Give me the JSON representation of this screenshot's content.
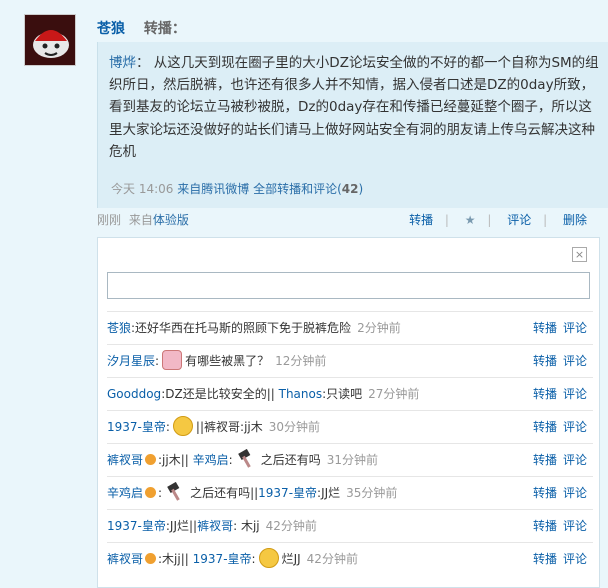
{
  "post": {
    "author": "苍狼",
    "action": "转播："
  },
  "quote": {
    "author": "博烨",
    "colon": "：",
    "text": "从这几天到现在圈子里的大小DZ论坛安全做的不好的都一个自称为SM的组织所日，然后脱裤，也许还有很多人并不知情，据入侵者口述是DZ的0day所致，看到基友的论坛立马被秒被脱，Dz的0day存在和传播已经蔓延整个圈子，所以这里大家论坛还没做好的站长们请马上做好网站安全有洞的朋友请上传乌云解决这种危机",
    "time": "今天 14:06",
    "source": "来自腾讯微博",
    "all_link": "全部转播和评论",
    "count_open": "(",
    "count": "42",
    "count_close": ")"
  },
  "subline": {
    "time": "刚刚",
    "via_prefix": "来自",
    "via": "体验版",
    "forward": "转播",
    "sep": "|",
    "star": "★",
    "comment": "评论",
    "delete": "删除"
  },
  "comment_box": {
    "close": "×",
    "placeholder": ""
  },
  "actions": {
    "forward": "转播",
    "comment": "评论"
  },
  "comments": [
    {
      "user": "苍狼",
      "text": ":还好华西在托马斯的照顾下免于脱裤危险",
      "time": "2分钟前"
    },
    {
      "user": "汐月星辰",
      "text": "有哪些被黑了？",
      "time": "12分钟前"
    },
    {
      "user": "Gooddog",
      "text": ":DZ还是比较安全的||",
      "user2": "Thanos",
      "text2": ":只读吧",
      "time": "27分钟前"
    },
    {
      "user": "1937-皇帝",
      "text": "||裤衩哥:",
      "text2": "jj木",
      "time": "30分钟前"
    },
    {
      "user": "裤衩哥",
      "text": ":jj木||",
      "user2": "辛鸡启",
      "text2": "之后还有吗",
      "time": "31分钟前"
    },
    {
      "user": "辛鸡启",
      "text": "之后还有吗||",
      "user2": "1937-皇帝",
      "text2": ":JJ烂",
      "time": "35分钟前"
    },
    {
      "user": "1937-皇帝",
      "text": ":JJ烂||",
      "user2": "裤衩哥",
      "text2": ": 木jj",
      "time": "42分钟前"
    },
    {
      "user": "裤衩哥",
      "text": ":木jj||",
      "user2": "1937-皇帝",
      "text2": "烂JJ",
      "time": "42分钟前"
    }
  ]
}
